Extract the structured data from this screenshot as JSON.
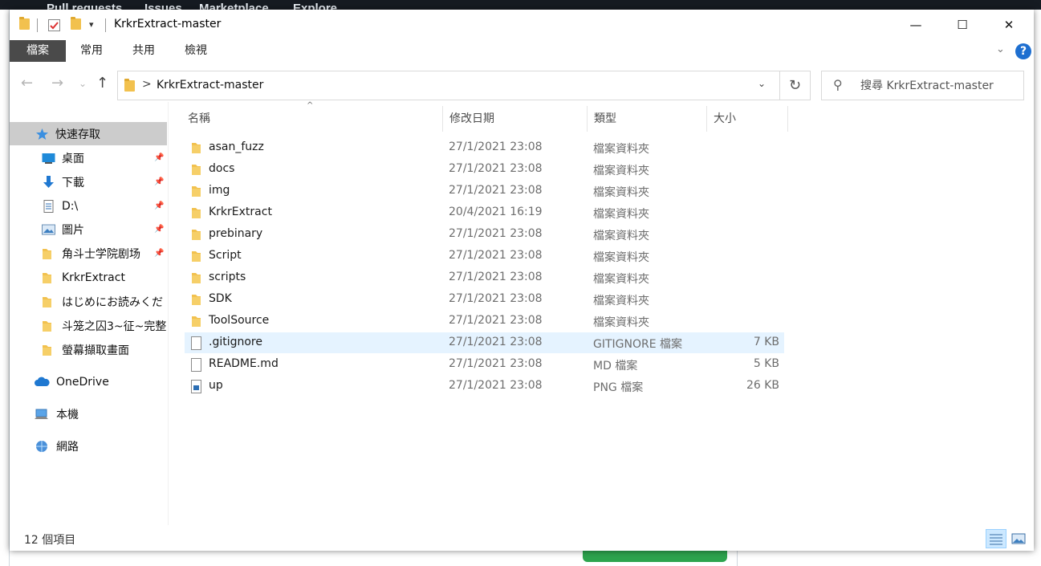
{
  "window": {
    "title": "KrkrExtract-master",
    "minimize_glyph": "—",
    "maximize_glyph": "☐",
    "close_glyph": "✕"
  },
  "background": {
    "nav_items": [
      "Pull requests",
      "Issues",
      "Marketplace",
      "Explore"
    ]
  },
  "ribbon": {
    "tabs": [
      "檔案",
      "常用",
      "共用",
      "檢視"
    ],
    "active_tab": "檔案",
    "expand_glyph": "⌄",
    "help_label": "?"
  },
  "navigation": {
    "back_glyph": "←",
    "forward_glyph": "→",
    "recent_glyph": "⌄",
    "up_glyph": "↑",
    "path_separator": ">",
    "path": "KrkrExtract-master",
    "dropdown_glyph": "⌄",
    "refresh_glyph": "↻",
    "search_placeholder": "搜尋 KrkrExtract-master"
  },
  "sidebar": {
    "quick_access": "快速存取",
    "pinned": [
      {
        "label": "桌面",
        "icon": "desktop-icon",
        "pinned": true
      },
      {
        "label": "下載",
        "icon": "download-icon",
        "pinned": true
      },
      {
        "label": "D:\\",
        "icon": "document-icon",
        "pinned": true
      },
      {
        "label": "圖片",
        "icon": "pictures-icon",
        "pinned": true
      },
      {
        "label": "角斗士学院剧场",
        "icon": "folder-icon",
        "pinned": true
      },
      {
        "label": "KrkrExtract",
        "icon": "folder-icon",
        "pinned": false
      },
      {
        "label": "はじめにお読みくだ",
        "icon": "folder-icon",
        "pinned": false
      },
      {
        "label": "斗笼之囚3~征~完整",
        "icon": "folder-icon",
        "pinned": false
      },
      {
        "label": "螢幕擷取畫面",
        "icon": "folder-icon",
        "pinned": false
      }
    ],
    "onedrive": "OneDrive",
    "this_pc": "本機",
    "network": "網路"
  },
  "columns": {
    "name": "名稱",
    "date": "修改日期",
    "type": "類型",
    "size": "大小"
  },
  "files": [
    {
      "name": "asan_fuzz",
      "date": "27/1/2021 23:08",
      "type": "檔案資料夾",
      "size": "",
      "kind": "folder"
    },
    {
      "name": "docs",
      "date": "27/1/2021 23:08",
      "type": "檔案資料夾",
      "size": "",
      "kind": "folder"
    },
    {
      "name": "img",
      "date": "27/1/2021 23:08",
      "type": "檔案資料夾",
      "size": "",
      "kind": "folder"
    },
    {
      "name": "KrkrExtract",
      "date": "20/4/2021 16:19",
      "type": "檔案資料夾",
      "size": "",
      "kind": "folder"
    },
    {
      "name": "prebinary",
      "date": "27/1/2021 23:08",
      "type": "檔案資料夾",
      "size": "",
      "kind": "folder"
    },
    {
      "name": "Script",
      "date": "27/1/2021 23:08",
      "type": "檔案資料夾",
      "size": "",
      "kind": "folder"
    },
    {
      "name": "scripts",
      "date": "27/1/2021 23:08",
      "type": "檔案資料夾",
      "size": "",
      "kind": "folder"
    },
    {
      "name": "SDK",
      "date": "27/1/2021 23:08",
      "type": "檔案資料夾",
      "size": "",
      "kind": "folder"
    },
    {
      "name": "ToolSource",
      "date": "27/1/2021 23:08",
      "type": "檔案資料夾",
      "size": "",
      "kind": "folder"
    },
    {
      "name": ".gitignore",
      "date": "27/1/2021 23:08",
      "type": "GITIGNORE 檔案",
      "size": "7 KB",
      "kind": "file",
      "highlighted": true
    },
    {
      "name": "README.md",
      "date": "27/1/2021 23:08",
      "type": "MD 檔案",
      "size": "5 KB",
      "kind": "file"
    },
    {
      "name": "up",
      "date": "27/1/2021 23:08",
      "type": "PNG 檔案",
      "size": "26 KB",
      "kind": "image"
    }
  ],
  "status": {
    "item_count": "12 個項目",
    "view_mode": "details"
  },
  "colors": {
    "folder": "#f2c14e",
    "accent": "#1e6fd0",
    "selection": "#cccccc",
    "hover_row": "#e5f3ff"
  }
}
